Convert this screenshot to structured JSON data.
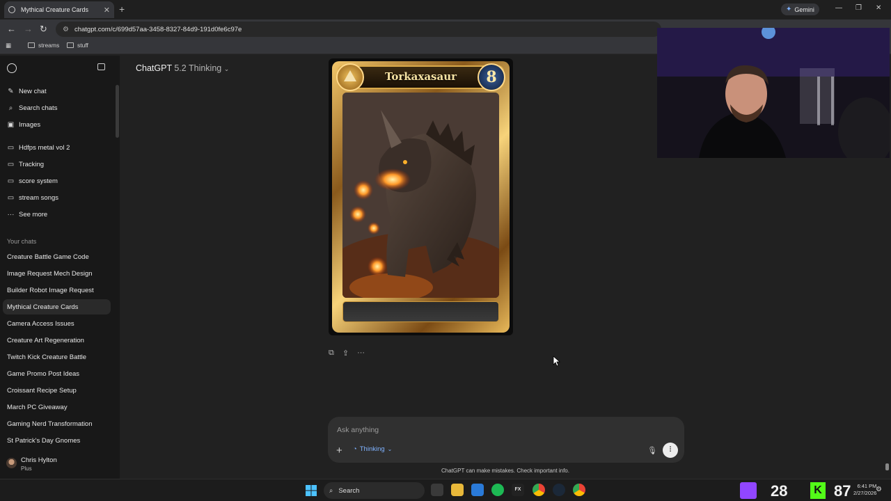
{
  "browser": {
    "tab_title": "Mythical Creature Cards",
    "url": "chatgpt.com/c/699d57aa-3458-8327-84d9-191d0fe6c97e",
    "gemini_label": "Gemini",
    "bookmarks": [
      "streams",
      "stuff"
    ]
  },
  "sidebar": {
    "top_items": [
      {
        "label": "New chat",
        "icon": "edit-icon"
      },
      {
        "label": "Search chats",
        "icon": "search-icon"
      },
      {
        "label": "Images",
        "icon": "image-icon"
      }
    ],
    "projects": [
      {
        "label": "Hdfps metal vol 2",
        "icon": "folder-icon"
      },
      {
        "label": "Tracking",
        "icon": "folder-icon"
      },
      {
        "label": "score system",
        "icon": "folder-icon"
      },
      {
        "label": "stream songs",
        "icon": "folder-icon"
      },
      {
        "label": "See more",
        "icon": "more-icon"
      }
    ],
    "your_chats_label": "Your chats",
    "chats": [
      "Creature Battle Game Code",
      "Image Request Mech Design",
      "Builder Robot Image Request",
      "Mythical Creature Cards",
      "Camera Access Issues",
      "Creature Art Regeneration",
      "Twitch Kick Creature Battle",
      "Game Promo Post Ideas",
      "Croissant Recipe Setup",
      "March PC Giveaway",
      "Gaming Nerd Transformation",
      "St Patrick's Day Gnomes"
    ],
    "active_chat": "Mythical Creature Cards",
    "user": {
      "name": "Chris Hylton",
      "plan": "Plus"
    }
  },
  "main": {
    "model_name": "ChatGPT",
    "model_version": "5.2 Thinking",
    "card": {
      "name": "Torkaxasaur",
      "cost": "8"
    },
    "composer": {
      "placeholder": "Ask anything",
      "mode_label": "Thinking"
    },
    "disclaimer": "ChatGPT can make mistakes. Check important info."
  },
  "taskbar": {
    "search_label": "Search",
    "twitch_count": "28",
    "kick_count": "87",
    "time": "6:41 PM",
    "date": "2/27/2026"
  }
}
